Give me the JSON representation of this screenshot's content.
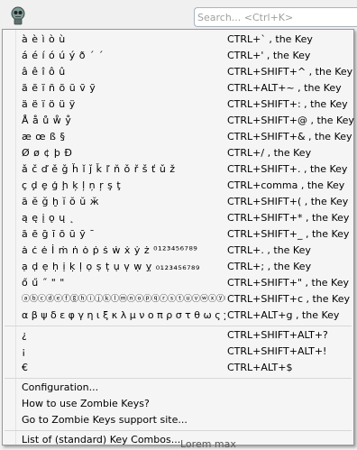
{
  "search": {
    "placeholder": "Search... <Ctrl+K>"
  },
  "character_rows": [
    {
      "chars": "à è ì ò ù",
      "shortcut": "CTRL+` , the Key"
    },
    {
      "chars": "á é í ó ú ý ð ´ ˊ",
      "shortcut": "CTRL+' , the Key"
    },
    {
      "chars": "â ê î ô û",
      "shortcut": "CTRL+SHIFT+^ , the Key"
    },
    {
      "chars": "ã ẽ ĩ ñ õ ũ ṽ ỹ",
      "shortcut": "CTRL+ALT+~ , the Key"
    },
    {
      "chars": "ä ë ï ö ü ÿ",
      "shortcut": "CTRL+SHIFT+: , the Key"
    },
    {
      "chars": "Å å ů ẘ ẙ",
      "shortcut": "CTRL+SHIFT+@ , the Key"
    },
    {
      "chars": "æ œ ß §",
      "shortcut": "CTRL+SHIFT+& , the Key"
    },
    {
      "chars": "Ø ø ¢ þ Ð",
      "shortcut": "CTRL+/ , the Key"
    },
    {
      "chars": "ǎ č ď ě ǧ ȟ ǐ ǰ ǩ ľ ň ǒ ř š ť ǔ ž",
      "shortcut": "CTRL+SHIFT+. , the Key"
    },
    {
      "chars": "ç ḑ ȩ ģ ḩ ķ ļ ņ ŗ ş ţ",
      "shortcut": "CTRL+comma , the Key"
    },
    {
      "chars": "ă ĕ ğ ḫ ĭ ŏ ŭ ӂ",
      "shortcut": "CTRL+SHIFT+( , the Key"
    },
    {
      "chars": "ą ę į ǫ ų ˛",
      "shortcut": "CTRL+SHIFT+* , the Key"
    },
    {
      "chars": "ā ē ḡ ī ō ū ȳ ¯",
      "shortcut": "CTRL+SHIFT+_ , the Key"
    },
    {
      "chars": "ȧ ċ ė İ ṁ ṅ ȯ ṗ ṡ ẇ ẋ ẏ ż ⁰¹²³⁴⁵⁶⁷⁸⁹",
      "shortcut": "CTRL+. , the Key"
    },
    {
      "chars": "ạ ḍ ẹ ḥ ị ḳ ḷ ọ ṣ ṭ ụ ṿ ẉ ỵ ₀₁₂₃₄₅₆₇₈₉",
      "shortcut": "CTRL+; , the Key"
    },
    {
      "chars": "ő ű ˝ \" \"",
      "shortcut": "CTRL+SHIFT+\" , the Key"
    },
    {
      "chars": "ⓐⓑⓒⓓⓔⓕⓖⓗⓘⓙⓚⓛⓜⓝⓞⓟⓠⓡⓢⓣⓤⓥⓦⓧⓨⓩ",
      "shortcut": "CTRL+SHIFT+c , the Key"
    },
    {
      "chars": "α β ψ δ ε φ γ η ι ξ κ λ μ ν ο π ρ σ τ θ ω ς χ υ ζ",
      "shortcut": "CTRL+ALT+g , the Key"
    }
  ],
  "symbol_rows": [
    {
      "chars": "¿",
      "shortcut": "CTRL+SHIFT+ALT+?"
    },
    {
      "chars": "¡",
      "shortcut": "CTRL+SHIFT+ALT+!"
    },
    {
      "chars": "€",
      "shortcut": "CTRL+ALT+$"
    }
  ],
  "commands": [
    "Configuration...",
    "How to use Zombie Keys?",
    "Go to Zombie Keys support site...",
    "List of (standard) Key Combos..."
  ],
  "background_text": "Lorem max",
  "colors": {
    "menu_bg": "#f5f5f5",
    "border": "#979797",
    "separator": "#d7d7d7"
  }
}
